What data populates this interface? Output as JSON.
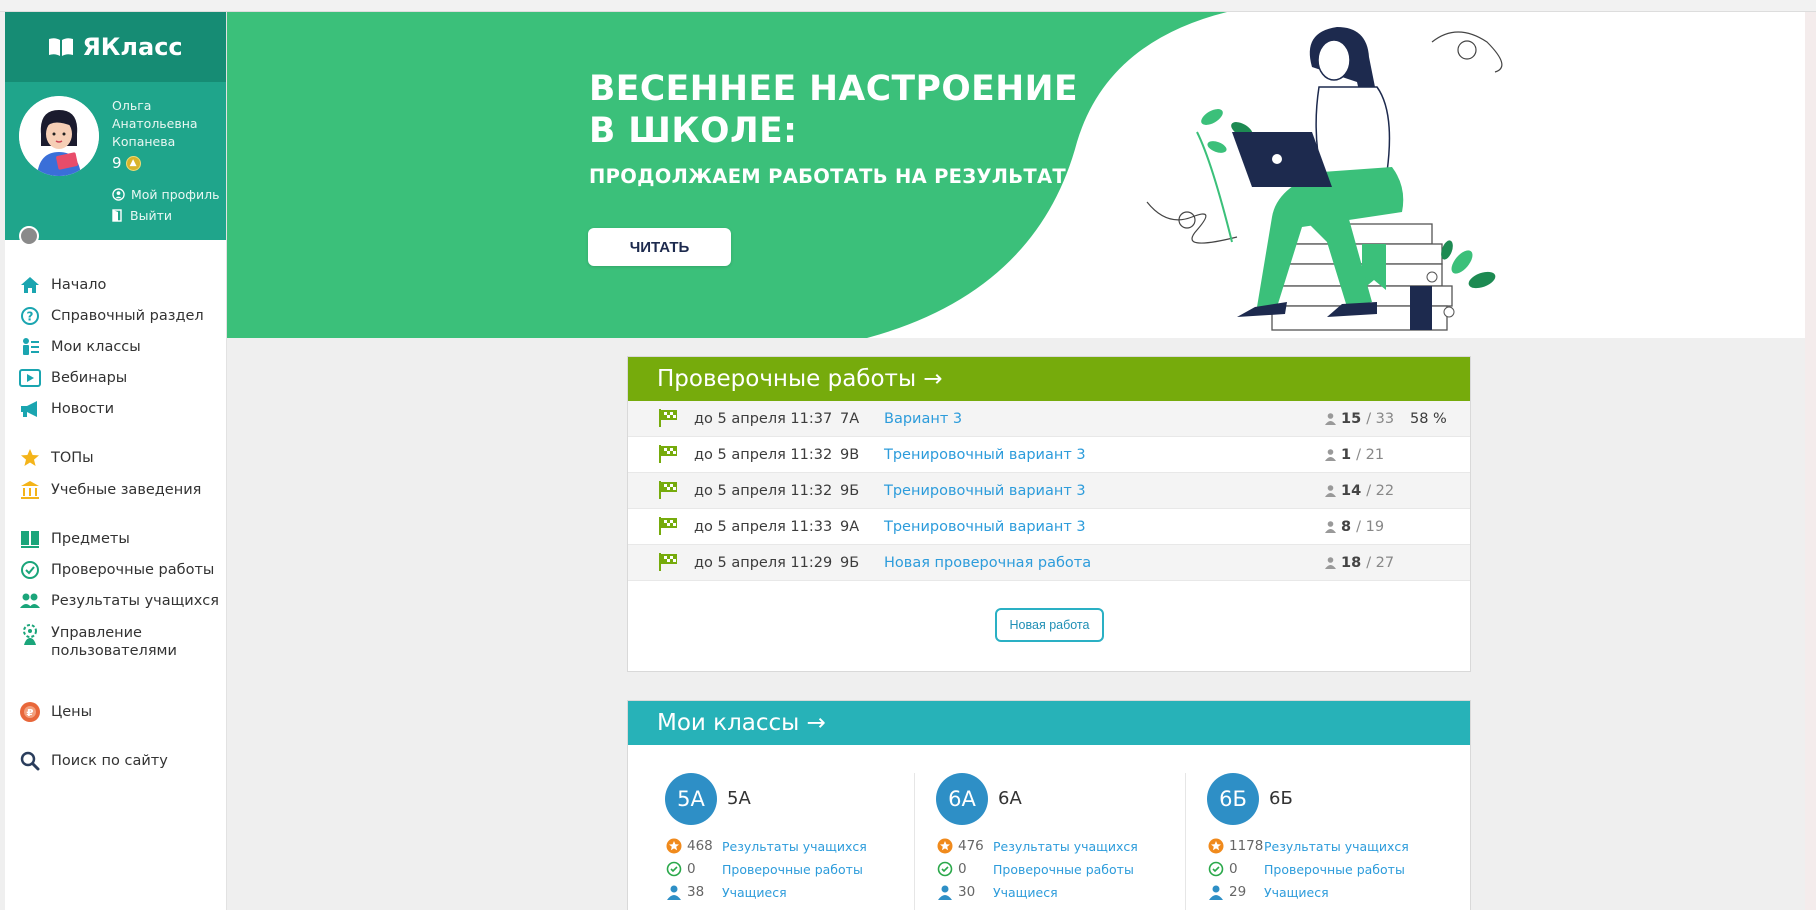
{
  "colors": {
    "brand_dark": "#168c74",
    "brand": "#1fa58b",
    "banner_green": "#3bc07a",
    "tests_header": "#76ab0c",
    "classes_header": "#27b2b8",
    "link": "#2d9cdb",
    "class_circle": "#2e8fc6"
  },
  "logo": {
    "text": "ЯКласс",
    "icon": "open-book-icon"
  },
  "user": {
    "first_name": "Ольга",
    "middle_name": "Анатольевна",
    "last_name": "Копанева",
    "points": "9",
    "profile_link": "Мой профиль",
    "logout_link": "Выйти"
  },
  "nav": [
    {
      "label": "Начало",
      "icon": "home-icon"
    },
    {
      "label": "Справочный раздел",
      "icon": "help-icon"
    },
    {
      "label": "Мои классы",
      "icon": "classes-icon"
    },
    {
      "label": "Вебинары",
      "icon": "video-icon"
    },
    {
      "label": "Новости",
      "icon": "megaphone-icon"
    },
    {
      "label": "ТОПы",
      "icon": "star-icon"
    },
    {
      "label": "Учебные заведения",
      "icon": "building-icon"
    },
    {
      "label": "Предметы",
      "icon": "books-icon"
    },
    {
      "label": "Проверочные работы",
      "icon": "check-icon"
    },
    {
      "label": "Результаты учащихся",
      "icon": "users-icon"
    },
    {
      "label": "Управление пользователями",
      "icon": "users-gear-icon"
    },
    {
      "label": "Цены",
      "icon": "price-icon"
    },
    {
      "label": "Поиск по сайту",
      "icon": "search-icon"
    }
  ],
  "banner": {
    "title_line1": "ВЕСЕННЕЕ НАСТРОЕНИЕ",
    "title_line2": "В ШКОЛЕ:",
    "subtitle": "ПРОДОЛЖАЕМ РАБОТАТЬ НА РЕЗУЛЬТАТ",
    "button": "ЧИТАТЬ"
  },
  "tests": {
    "header": "Проверочные работы →",
    "rows": [
      {
        "date": "до 5 апреля 11:37",
        "class": "7А",
        "name": "Вариант 3",
        "done": "15",
        "total": "/ 33",
        "percent": "58 %"
      },
      {
        "date": "до 5 апреля 11:32",
        "class": "9В",
        "name": "Тренировочный вариант 3",
        "done": "1",
        "total": "/ 21",
        "percent": ""
      },
      {
        "date": "до 5 апреля 11:32",
        "class": "9Б",
        "name": "Тренировочный вариант 3",
        "done": "14",
        "total": "/ 22",
        "percent": ""
      },
      {
        "date": "до 5 апреля 11:33",
        "class": "9А",
        "name": "Тренировочный вариант 3",
        "done": "8",
        "total": "/ 19",
        "percent": ""
      },
      {
        "date": "до 5 апреля 11:29",
        "class": "9Б",
        "name": "Новая проверочная работа",
        "done": "18",
        "total": "/ 27",
        "percent": ""
      }
    ],
    "new_button": "Новая работа"
  },
  "classes": {
    "header": "Мои классы →",
    "items": [
      {
        "badge": "5А",
        "name": "5А",
        "points": "468",
        "tests": "0",
        "students": "38"
      },
      {
        "badge": "6А",
        "name": "6А",
        "points": "476",
        "tests": "0",
        "students": "30"
      },
      {
        "badge": "6Б",
        "name": "6Б",
        "points": "1178",
        "tests": "0",
        "students": "29"
      }
    ],
    "results_link": "Результаты учащихся",
    "tests_link": "Проверочные работы",
    "students_link": "Учащиеся"
  }
}
